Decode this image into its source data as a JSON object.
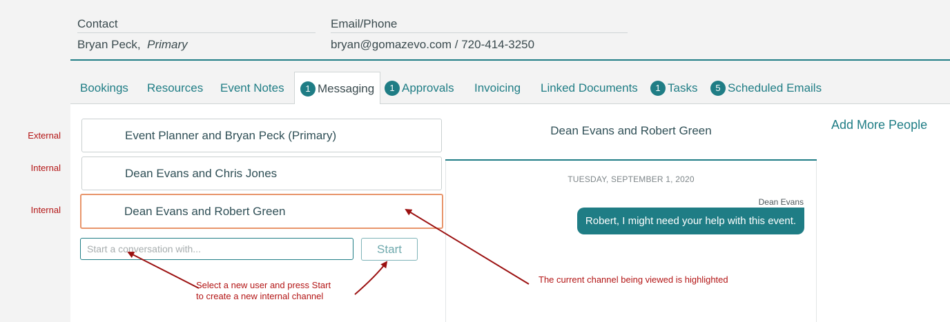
{
  "contact": {
    "contact_label": "Contact",
    "contact_name": "Bryan Peck,",
    "contact_role": "Primary",
    "email_label": "Email/Phone",
    "email_value": "bryan@gomazevo.com / 720-414-3250"
  },
  "tabs": [
    {
      "label": "Bookings"
    },
    {
      "label": "Resources"
    },
    {
      "label": "Event Notes"
    },
    {
      "label": "Messaging",
      "badge": "1",
      "active": true
    },
    {
      "label": "Approvals",
      "badge": "1"
    },
    {
      "label": "Invoicing"
    },
    {
      "label": "Linked Documents"
    },
    {
      "label": "Tasks",
      "badge": "1"
    },
    {
      "label": "Scheduled Emails",
      "badge": "5"
    }
  ],
  "channels": [
    {
      "label": "Event Planner and Bryan Peck (Primary)",
      "type": "External"
    },
    {
      "label": "Dean Evans and Chris Jones",
      "type": "Internal"
    },
    {
      "label": "Dean Evans and Robert Green",
      "type": "Internal",
      "highlighted": true
    }
  ],
  "new_conversation": {
    "placeholder": "Start a conversation with...",
    "start_label": "Start"
  },
  "chat": {
    "title": "Dean Evans and Robert Green",
    "date": "TUESDAY, SEPTEMBER 1, 2020",
    "messages": [
      {
        "sender": "Dean Evans",
        "text": "Robert, I might need your help with this event."
      }
    ]
  },
  "add_people_label": "Add More People",
  "annotations": {
    "new_channel_line1": "Select a new user and press Start",
    "new_channel_line2": "to create a new internal channel",
    "highlight_note": "The current channel being viewed is highlighted"
  },
  "colors": {
    "accent": "#1f7d85",
    "highlight_border": "#e8956b",
    "annotation": "#b31515"
  }
}
